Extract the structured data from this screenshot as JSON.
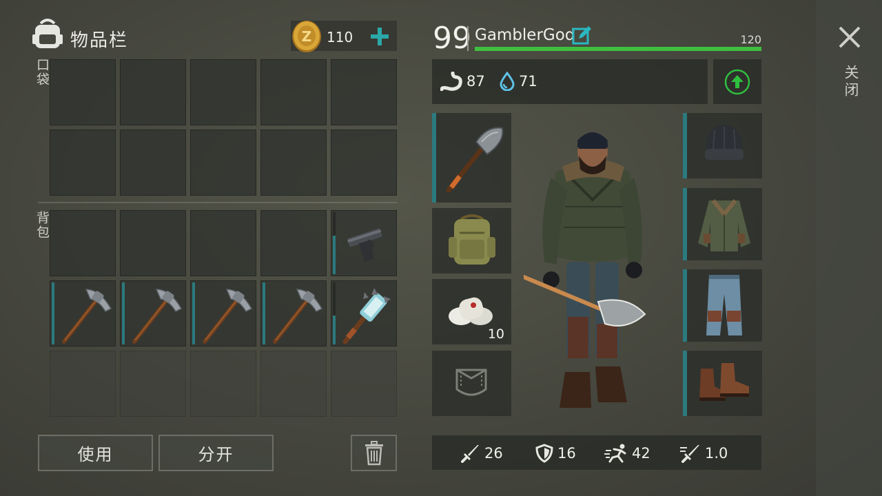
{
  "inventory": {
    "title": "物品栏",
    "coins": "110",
    "pockets_label": "口袋",
    "backpack_label": "背包"
  },
  "buttons": {
    "use": "使用",
    "split": "分开"
  },
  "character": {
    "level": "99",
    "name": "GamblerGod",
    "xp_max": "120",
    "hunger": "87",
    "thirst": "71"
  },
  "equipment": {
    "consumable_count": "10"
  },
  "stats": {
    "attack": "26",
    "defense": "16",
    "speed": "42",
    "attack_speed": "1.0"
  },
  "close": {
    "label": "关闭"
  },
  "colors": {
    "accent": "#2b7a7e",
    "xp_bar": "#3fbf3f",
    "upgrade": "#2fbf3f",
    "plus": "#2aa8a8",
    "coin": "#d4a033"
  }
}
